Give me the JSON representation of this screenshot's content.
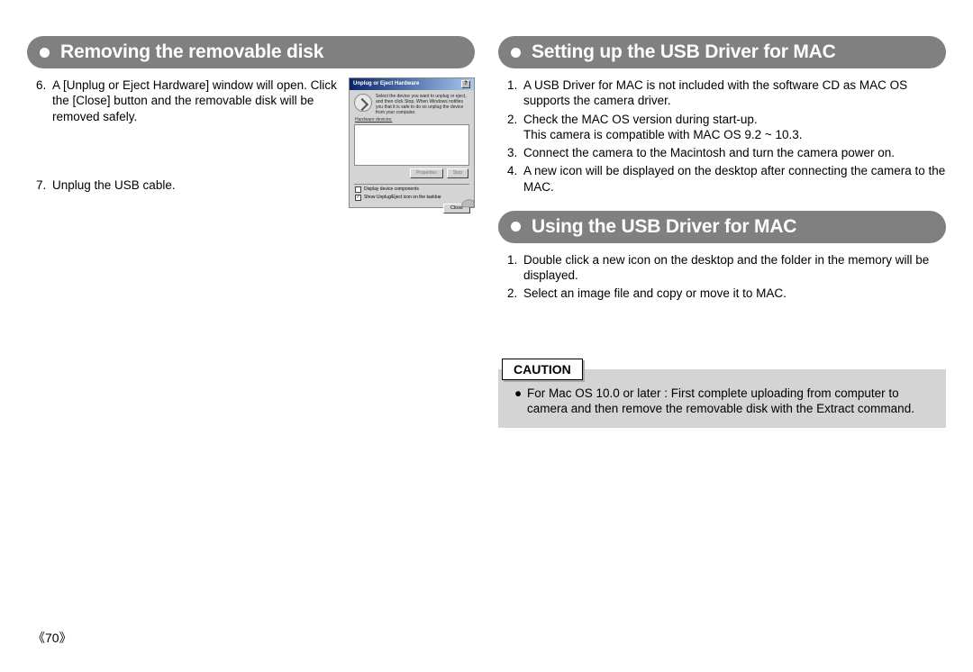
{
  "page_number": "《70》",
  "left": {
    "heading": "Removing the removable disk",
    "items": [
      {
        "n": "6.",
        "t": "A [Unplug or Eject Hardware] window will open. Click the [Close] button and the removable disk will be removed safely."
      },
      {
        "n": "7.",
        "t": "Unplug the USB cable."
      }
    ],
    "dialog": {
      "title": "Unplug or Eject Hardware",
      "msg": "Select the device you want to unplug or eject, and then click Stop. When Windows notifies you that it is safe to do so unplug the device from your computer.",
      "field_label": "Hardware devices:",
      "btn1": "Properties",
      "btn2": "Stop",
      "chk1": "Display device components",
      "chk2": "Show Unplug/Eject icon on the taskbar",
      "close": "Close"
    }
  },
  "right": {
    "section1": {
      "heading": "Setting up the USB Driver for MAC",
      "items": [
        {
          "n": "1.",
          "t": "A USB Driver for MAC is not included with the software CD as MAC OS supports the camera driver."
        },
        {
          "n": "2.",
          "t": "Check the MAC OS version during start-up.",
          "t2": "This camera is compatible with MAC OS 9.2 ~ 10.3."
        },
        {
          "n": "3.",
          "t": "Connect the camera to the Macintosh and turn the camera power on."
        },
        {
          "n": "4.",
          "t": "A new icon will be displayed on the desktop after connecting the camera to the MAC."
        }
      ]
    },
    "section2": {
      "heading": "Using the USB Driver for MAC",
      "items": [
        {
          "n": "1.",
          "t": "Double click a new icon on the desktop and the folder in the memory will be displayed."
        },
        {
          "n": "2.",
          "t": "Select an image file and copy or move it to MAC."
        }
      ]
    },
    "caution": {
      "label": "CAUTION",
      "text": "For Mac OS 10.0 or later : First complete uploading from computer to camera and then remove the removable disk with the Extract command."
    }
  }
}
